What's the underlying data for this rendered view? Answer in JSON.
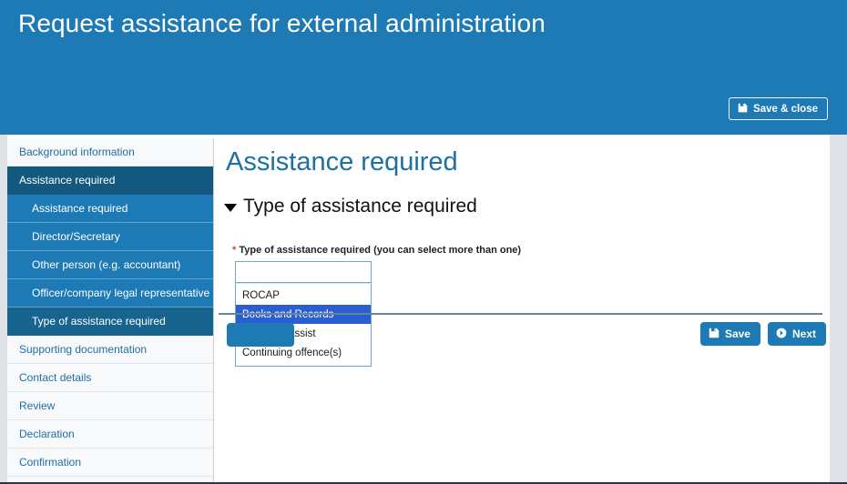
{
  "header": {
    "title": "Request assistance for external administration",
    "save_close_label": "Save & close",
    "save_close_icon": "floppy-disk-icon",
    "background_color": "#1d7ab4"
  },
  "sidebar": {
    "items": [
      {
        "label": "Background information",
        "state": "default",
        "level": "top"
      },
      {
        "label": "Assistance required",
        "state": "section-active",
        "level": "top"
      },
      {
        "label": "Assistance required",
        "state": "sub",
        "level": "sub"
      },
      {
        "label": "Director/Secretary",
        "state": "sub",
        "level": "sub"
      },
      {
        "label": "Other person (e.g. accountant)",
        "state": "sub",
        "level": "sub"
      },
      {
        "label": "Officer/company legal representative",
        "state": "sub",
        "level": "sub"
      },
      {
        "label": "Type of assistance required",
        "state": "sub-active",
        "level": "sub"
      },
      {
        "label": "Supporting documentation",
        "state": "default",
        "level": "top"
      },
      {
        "label": "Contact details",
        "state": "default",
        "level": "top"
      },
      {
        "label": "Review",
        "state": "default",
        "level": "top"
      },
      {
        "label": "Declaration",
        "state": "default",
        "level": "top"
      },
      {
        "label": "Confirmation",
        "state": "default",
        "level": "top"
      }
    ],
    "active_section_color": "#12587f",
    "sub_item_color": "#1d7ab4",
    "active_sub_item_color": "#17648f",
    "link_color": "#1d6fa5"
  },
  "main": {
    "page_title": "Assistance required",
    "section_heading": "Type of assistance required",
    "section_caret_icon": "caret-down-icon",
    "field": {
      "required_marker": "*",
      "label": "Type of assistance required (you can select more than one)",
      "input_value": "",
      "placeholder": "",
      "options": [
        {
          "label": "ROCAP",
          "highlighted": false
        },
        {
          "label": "Books and Records",
          "highlighted": true
        },
        {
          "label": "Failure to assist",
          "highlighted": false
        },
        {
          "label": "Continuing offence(s)",
          "highlighted": false
        }
      ],
      "highlight_color": "#2a5fd4"
    },
    "footer": {
      "save_label": "Save",
      "save_icon": "floppy-disk-icon",
      "next_label": "Next",
      "next_icon": "arrow-circle-right-icon"
    }
  }
}
